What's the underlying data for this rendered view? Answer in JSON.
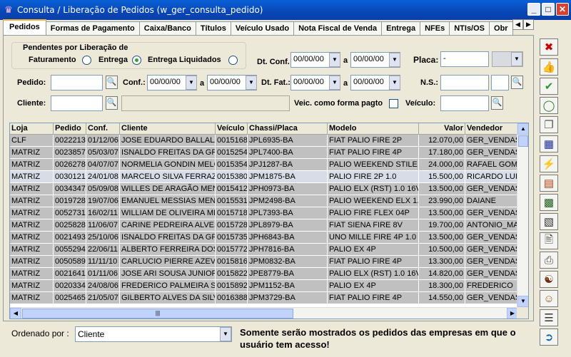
{
  "window": {
    "title": "Consulta / Liberação de Pedidos (w_ger_consulta_pedido)"
  },
  "tabs": [
    {
      "label": "Pedidos"
    },
    {
      "label": "Formas de Pagamento"
    },
    {
      "label": "Caixa/Banco"
    },
    {
      "label": "Títulos"
    },
    {
      "label": "Veículo Usado"
    },
    {
      "label": "Nota Fiscal de Venda"
    },
    {
      "label": "Entrega"
    },
    {
      "label": "NFEs"
    },
    {
      "label": "NTIs/OS"
    },
    {
      "label": "Obr"
    }
  ],
  "filters": {
    "pendentes_label": "Pendentes por Liberação de",
    "opt_faturamento": "Faturamento",
    "opt_entrega": "Entrega",
    "opt_entrega_liquidados": "Entrega Liquidados",
    "selected_option": "Entrega",
    "dt_conf_label": "Dt. Conf.",
    "dt_conf_from": "00/00/00",
    "dt_conf_to": "00/00/00",
    "a1": "a",
    "placa_label": "Placa:",
    "placa_value": "-",
    "pedido_label": "Pedido:",
    "pedido_value": "",
    "conf_label": "Conf.:",
    "conf_from": "00/00/00",
    "conf_to": "00/00/00",
    "a2": "a",
    "dt_fat_label": "Dt. Fat.:",
    "dt_fat_from": "00/00/00",
    "dt_fat_to": "00/00/00",
    "a3": "a",
    "ns_label": "N.S.:",
    "ns_value": "",
    "cliente_label": "Cliente:",
    "cliente_value": "",
    "cliente_nome": "",
    "veic_pagto_label": "Veic. como forma pagto",
    "veic_pagto_checked": false,
    "veiculo_label": "Veículo:",
    "veiculo_value": ""
  },
  "grid": {
    "columns": [
      "Loja",
      "Pedido",
      "Conf.",
      "Cliente",
      "Veículo",
      "Chassi/Placa",
      "Modelo",
      "Valor",
      "Vendedor"
    ],
    "rows": [
      [
        "CLF",
        "0022213",
        "01/12/06",
        "JOSE EDUARDO BALLALA",
        "0015168",
        "JPL6935-BA",
        "FIAT PALIO FIRE 2P",
        "12.070,00",
        "GER_VENDAS"
      ],
      [
        "MATRIZ",
        "0023857",
        "05/03/07",
        "ISNALDO FREITAS DA GRA",
        "0015254",
        "JPL7400-BA",
        "FIAT PALIO FIRE 4P",
        "17.180,00",
        "GER_VENDAS"
      ],
      [
        "MATRIZ",
        "0026278",
        "04/07/07",
        "NORMELIA GONDIN MELO",
        "0015354",
        "JPJ1287-BA",
        "PALIO WEEKEND STILE 1.6",
        "24.000,00",
        "RAFAEL GOME"
      ],
      [
        "MATRIZ",
        "0030121",
        "24/01/08",
        "MARCELO SILVA FERRAZ D",
        "0015380",
        "JPM1875-BA",
        "PALIO FIRE 2P 1.0",
        "15.500,00",
        "RICARDO LUIS"
      ],
      [
        "MATRIZ",
        "0034347",
        "05/09/08",
        "WILLES DE ARAGÃO MENE",
        "0015412",
        "JPH0973-BA",
        "PALIO ELX (RST) 1.0 16V",
        "13.500,00",
        "GER_VENDAS"
      ],
      [
        "MATRIZ",
        "0019728",
        "19/07/06",
        "EMANUEL MESSIAS MENDE",
        "0015531",
        "JPM2498-BA",
        "PALIO WEEKEND ELX 1.0",
        "23.990,00",
        "DAIANE"
      ],
      [
        "MATRIZ",
        "0052731",
        "16/02/11",
        "WILLIAM DE OLIVEIRA MEN",
        "0015718",
        "JPL7393-BA",
        "PALIO FIRE FLEX 04P",
        "13.500,00",
        "GER_VENDAS"
      ],
      [
        "MATRIZ",
        "0025828",
        "11/06/07",
        "CARINE PEDREIRA ALVES M",
        "0015728",
        "JPL8979-BA",
        "FIAT SIENA FIRE 8V",
        "19.700,00",
        "ANTONIO_MAR"
      ],
      [
        "MATRIZ",
        "0021493",
        "25/10/06",
        "ISNALDO FREITAS DA GRA",
        "0015735",
        "JPH6843-BA",
        "UNO MILLE FIRE 4P 1.0",
        "13.500,00",
        "GER_VENDAS"
      ],
      [
        "MATRIZ",
        "0055294",
        "22/06/11",
        "ALBERTO FERREIRA DOS S",
        "0015772",
        "JPH7816-BA",
        "PALIO EX  4P",
        "10.500,00",
        "GER_VENDAS"
      ],
      [
        "MATRIZ",
        "0050589",
        "11/11/10",
        "CARLUCIO PIERRE AZEVED",
        "0015816",
        "JPM0832-BA",
        "FIAT PALIO FIRE 4P",
        "13.300,00",
        "GER_VENDAS"
      ],
      [
        "MATRIZ",
        "0021641",
        "01/11/06",
        "JOSE ARI SOUSA JUNIOR",
        "0015822",
        "JPE8779-BA",
        "PALIO ELX (RST) 1.0 16V",
        "14.820,00",
        "GER_VENDAS"
      ],
      [
        "MATRIZ",
        "0020334",
        "24/08/06",
        "FREDERICO PALMEIRA SAN",
        "0015892",
        "JPM1152-BA",
        "PALIO EX  4P",
        "18.300,00",
        "FREDERICO"
      ],
      [
        "MATRIZ",
        "0025465",
        "21/05/07",
        "GILBERTO ALVES DA SILVA",
        "0016388",
        "JPM3729-BA",
        "FIAT PALIO FIRE 4P",
        "14.550,00",
        "GER_VENDAS"
      ]
    ],
    "selected_row": 3
  },
  "bottom": {
    "ordenado_label": "Ordenado por :",
    "ordenado_value": "Cliente",
    "note": "Somente serão mostrados os pedidos das empresas em que o usuário tem acesso!"
  },
  "toolbar": [
    "close-x",
    "thumbs-up",
    "check",
    "money-bag",
    "copy",
    "grid",
    "runner",
    "report",
    "table-edit",
    "calculator",
    "preview",
    "print",
    "person-doc",
    "people-doc",
    "list",
    "exit"
  ],
  "colors": {
    "title": "#0846b8",
    "grid_row": "#c0c0c0",
    "grid_selected": "#d7dce7",
    "tab_accent": "#f9b43a"
  }
}
